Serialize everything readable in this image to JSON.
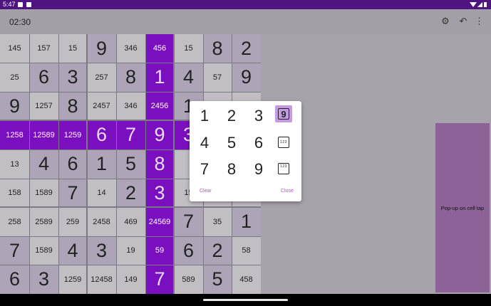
{
  "status_bar": {
    "time": "5:47"
  },
  "app_bar": {
    "timer": "02:30",
    "settings_icon": "gear-icon",
    "undo_icon": "undo-icon",
    "menu_icon": "more-vert-icon"
  },
  "colors": {
    "status_bar": "#4e1580",
    "selected": "#7a0fbf",
    "popup_accent": "#c04fd0",
    "side_panel": "#8c6299"
  },
  "board": {
    "rows": [
      [
        "145",
        "157",
        "15",
        "9",
        "346",
        "456",
        "15",
        "8",
        "2"
      ],
      [
        "25",
        "6",
        "3",
        "257",
        "8",
        "1",
        "4",
        "57",
        "9"
      ],
      [
        "9",
        "1257",
        "8",
        "2457",
        "346",
        "2456",
        "1",
        "",
        ""
      ],
      [
        "1258",
        "12589",
        "1259",
        "6",
        "7",
        "9",
        "3",
        "",
        ""
      ],
      [
        "13",
        "4",
        "6",
        "1",
        "5",
        "8",
        "",
        "",
        ""
      ],
      [
        "158",
        "1589",
        "7",
        "14",
        "2",
        "3",
        "15",
        "",
        ""
      ],
      [
        "258",
        "2589",
        "259",
        "2458",
        "469",
        "24569",
        "7",
        "35",
        "1"
      ],
      [
        "7",
        "1589",
        "4",
        "3",
        "19",
        "59",
        "6",
        "2",
        "58"
      ],
      [
        "6",
        "3",
        "1259",
        "12458",
        "149",
        "7",
        "589",
        "5",
        "458"
      ]
    ]
  },
  "popup": {
    "numbers": [
      "1",
      "2",
      "3",
      "4",
      "5",
      "6",
      "7",
      "8",
      "9"
    ],
    "value_mode_label": "9",
    "candidate_mode_label": "123",
    "clear_label": "Clear",
    "close_label": "Close"
  },
  "side_panel": {
    "label": "Pop-up on cell tap"
  }
}
